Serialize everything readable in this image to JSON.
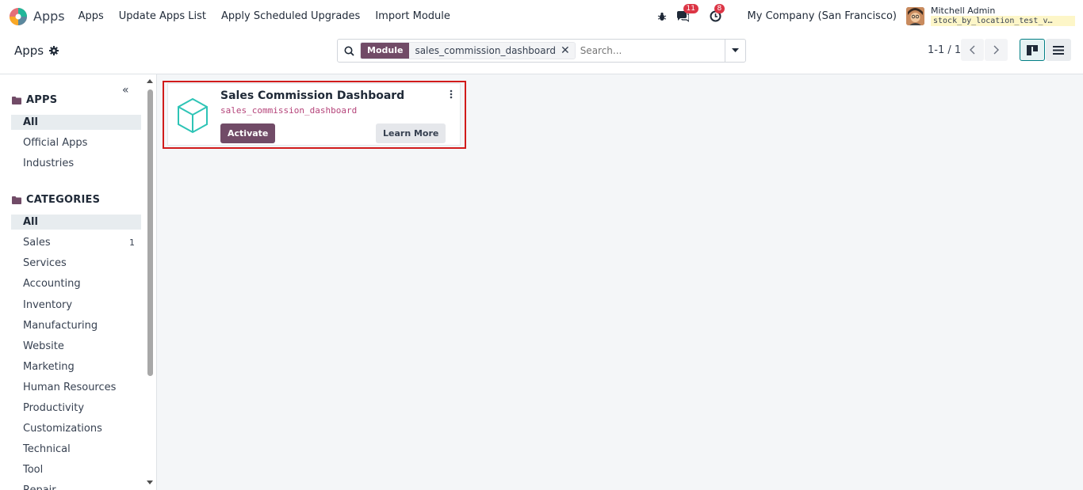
{
  "navbar": {
    "app_name": "Apps",
    "menu": [
      "Apps",
      "Update Apps List",
      "Apply Scheduled Upgrades",
      "Import Module"
    ],
    "messages_count": "11",
    "activities_count": "8",
    "company": "My Company (San Francisco)",
    "user_name": "Mitchell Admin",
    "database": "stock_by_location_test_v…"
  },
  "control": {
    "title": "Apps",
    "facet_label": "Module",
    "facet_value": "sales_commission_dashboard",
    "search_placeholder": "Search...",
    "pager": "1-1 / 1"
  },
  "sidebar": {
    "apps_title": "APPS",
    "apps_items": [
      {
        "label": "All",
        "active": true
      },
      {
        "label": "Official Apps"
      },
      {
        "label": "Industries"
      }
    ],
    "categories_title": "CATEGORIES",
    "categories": [
      {
        "label": "All",
        "active": true
      },
      {
        "label": "Sales",
        "count": "1"
      },
      {
        "label": "Services"
      },
      {
        "label": "Accounting"
      },
      {
        "label": "Inventory"
      },
      {
        "label": "Manufacturing"
      },
      {
        "label": "Website"
      },
      {
        "label": "Marketing"
      },
      {
        "label": "Human Resources"
      },
      {
        "label": "Productivity"
      },
      {
        "label": "Customizations"
      },
      {
        "label": "Technical"
      },
      {
        "label": "Tool"
      },
      {
        "label": "Repair"
      }
    ]
  },
  "card": {
    "title": "Sales Commission Dashboard",
    "technical_name": "sales_commission_dashboard",
    "activate_label": "Activate",
    "learn_more_label": "Learn More"
  },
  "colors": {
    "brand": "#714b67",
    "accent": "#017e84",
    "badge": "#dc3545",
    "highlight": "#d11b1b",
    "module_icon": "#2ec4b6"
  }
}
